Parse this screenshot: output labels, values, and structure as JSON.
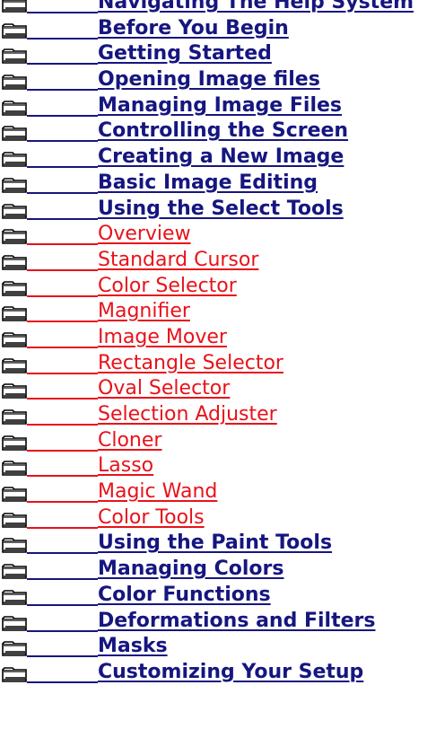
{
  "topics": [
    {
      "label": "Navigating The Help System",
      "kind": "bold"
    },
    {
      "label": "Before You Begin",
      "kind": "bold"
    },
    {
      "label": "Getting Started",
      "kind": "bold"
    },
    {
      "label": "Opening Image files",
      "kind": "bold"
    },
    {
      "label": "Managing Image Files",
      "kind": "bold"
    },
    {
      "label": "Controlling the Screen",
      "kind": "bold"
    },
    {
      "label": "Creating a New Image",
      "kind": "bold"
    },
    {
      "label": "Basic Image Editing",
      "kind": "bold"
    },
    {
      "label": "Using the Select Tools",
      "kind": "bold"
    },
    {
      "label": "Overview",
      "kind": "sub"
    },
    {
      "label": "Standard Cursor",
      "kind": "sub"
    },
    {
      "label": "Color Selector",
      "kind": "sub"
    },
    {
      "label": "Magnifier",
      "kind": "sub"
    },
    {
      "label": "Image Mover",
      "kind": "sub"
    },
    {
      "label": "Rectangle Selector",
      "kind": "sub"
    },
    {
      "label": "Oval Selector",
      "kind": "sub"
    },
    {
      "label": "Selection Adjuster",
      "kind": "sub"
    },
    {
      "label": "Cloner",
      "kind": "sub"
    },
    {
      "label": "Lasso",
      "kind": "sub"
    },
    {
      "label": "Magic Wand",
      "kind": "sub"
    },
    {
      "label": "Color Tools",
      "kind": "sub"
    },
    {
      "label": "Using the Paint Tools",
      "kind": "bold"
    },
    {
      "label": "Managing Colors",
      "kind": "bold"
    },
    {
      "label": "Color Functions",
      "kind": "bold"
    },
    {
      "label": "Deformations and Filters",
      "kind": "bold"
    },
    {
      "label": "Masks",
      "kind": "bold"
    },
    {
      "label": "Customizing Your Setup",
      "kind": "bold"
    }
  ],
  "icons": {
    "folder": "folder-icon"
  },
  "colors": {
    "topic_link": "#161680",
    "subtopic_link": "#e8121a"
  }
}
